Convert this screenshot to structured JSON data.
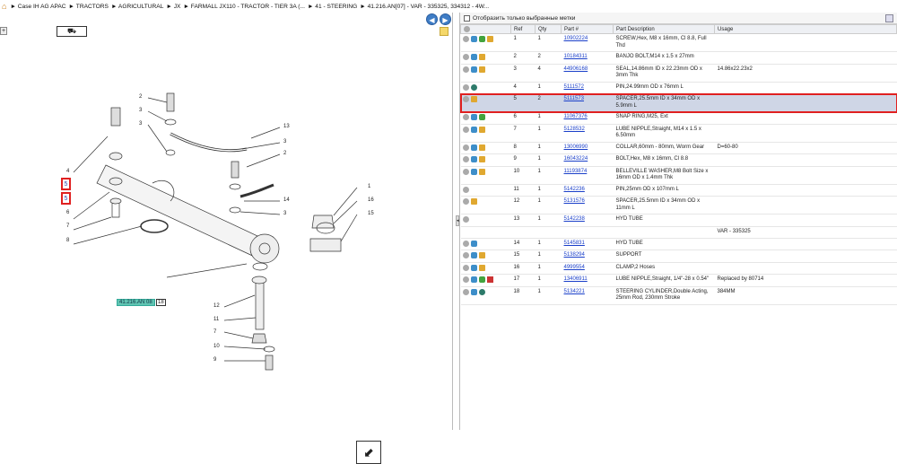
{
  "breadcrumb": {
    "items": [
      "Case IH AG APAC",
      "TRACTORS",
      "AGRICULTURAL",
      "JX",
      "FARMALL JX110 - TRACTOR - TIER 3A (...",
      "41 - STEERING",
      "41.216.AN[07] - VAR - 335325, 334312 - 4W..."
    ]
  },
  "filter": {
    "label": "Отобразить только выбранные метки"
  },
  "table": {
    "headers": [
      "",
      "Ref",
      "Qty",
      "Part #",
      "Part Description",
      "Usage"
    ],
    "rows": [
      {
        "ref": "1",
        "qty": "1",
        "part": "10902224",
        "desc": "SCREW,Hex, M8 x 16mm, Cl 8.8, Full Thd",
        "usage": "",
        "icons": [
          "grey",
          "arrow",
          "green",
          "box"
        ]
      },
      {
        "ref": "2",
        "qty": "2",
        "part": "10184311",
        "desc": "BANJO BOLT,M14 x 1.5 x 27mm",
        "usage": "",
        "icons": [
          "grey",
          "arrow",
          "box"
        ]
      },
      {
        "ref": "3",
        "qty": "4",
        "part": "44906168",
        "desc": "SEAL,14.86mm ID x 22.23mm OD x 3mm Thk",
        "usage": "14.86x22.23x2",
        "icons": [
          "grey",
          "arrow",
          "box"
        ]
      },
      {
        "ref": "4",
        "qty": "1",
        "part": "5111572",
        "desc": "PIN,24.99mm OD x 76mm L",
        "usage": "",
        "icons": [
          "grey",
          "wheel"
        ]
      },
      {
        "ref": "5",
        "qty": "2",
        "part": "5111573",
        "desc": "SPACER,25.5mm ID x 34mm OD x 5.9mm L",
        "usage": "",
        "icons": [
          "grey",
          "box"
        ],
        "selected": true
      },
      {
        "ref": "6",
        "qty": "1",
        "part": "11067376",
        "desc": "SNAP RING,M25, Ext",
        "usage": "",
        "icons": [
          "grey",
          "arrow",
          "green"
        ]
      },
      {
        "ref": "7",
        "qty": "1",
        "part": "5128532",
        "desc": "LUBE NIPPLE,Straight, M14 x 1.5 x 6.50mm",
        "usage": "",
        "icons": [
          "grey",
          "arrow",
          "box"
        ]
      },
      {
        "ref": "8",
        "qty": "1",
        "part": "13006990",
        "desc": "COLLAR,60mm - 80mm, Worm Gear",
        "usage": "D=60-80",
        "icons": [
          "grey",
          "arrow",
          "box"
        ]
      },
      {
        "ref": "9",
        "qty": "1",
        "part": "16043224",
        "desc": "BOLT,Hex, M8 x 16mm, Cl 8.8",
        "usage": "",
        "icons": [
          "grey",
          "arrow",
          "box"
        ]
      },
      {
        "ref": "10",
        "qty": "1",
        "part": "11193874",
        "desc": "BELLEVILLE WASHER,M8 Bolt Size x 16mm OD x 1.4mm Thk",
        "usage": "",
        "icons": [
          "grey",
          "arrow",
          "box"
        ]
      },
      {
        "ref": "11",
        "qty": "1",
        "part": "5142236",
        "desc": "PIN,25mm OD x 107mm L",
        "usage": "",
        "icons": [
          "grey"
        ]
      },
      {
        "ref": "12",
        "qty": "1",
        "part": "5131576",
        "desc": "SPACER,25.5mm ID x 34mm OD x 11mm L",
        "usage": "",
        "icons": [
          "grey",
          "box"
        ]
      },
      {
        "ref": "13",
        "qty": "1",
        "part": "5142238",
        "desc": "HYD TUBE",
        "usage": "",
        "icons": [
          "grey"
        ]
      },
      {
        "ref": "",
        "qty": "",
        "part": "",
        "desc": "",
        "usage": "VAR - 335325",
        "icons": []
      },
      {
        "ref": "14",
        "qty": "1",
        "part": "5145831",
        "desc": "HYD TUBE",
        "usage": "",
        "icons": [
          "grey",
          "arrow"
        ]
      },
      {
        "ref": "15",
        "qty": "1",
        "part": "5138294",
        "desc": "SUPPORT",
        "usage": "",
        "icons": [
          "grey",
          "arrow",
          "box"
        ]
      },
      {
        "ref": "16",
        "qty": "1",
        "part": "4999554",
        "desc": "CLAMP,2 Hoses",
        "usage": "",
        "icons": [
          "grey",
          "arrow",
          "box"
        ]
      },
      {
        "ref": "17",
        "qty": "1",
        "part": "13406911",
        "desc": "LUBE NIPPLE,Straight, 1/4\"-28 x 0.54\"",
        "usage": "Replaced by 80714",
        "icons": [
          "grey",
          "arrow",
          "green",
          "flag"
        ]
      },
      {
        "ref": "18",
        "qty": "1",
        "part": "5134221",
        "desc": "STEERING CYLINDER,Double Acting, 25mm Rod, 230mm Stroke",
        "usage": "384MM",
        "icons": [
          "grey",
          "arrow",
          "wheel"
        ]
      }
    ]
  },
  "diagram": {
    "ref_label": "41.216.AN 08",
    "ref_num": "18",
    "callouts": [
      "2",
      "3",
      "3",
      "13",
      "3",
      "2",
      "4",
      "5",
      "5",
      "6",
      "7",
      "8",
      "14",
      "3",
      "1",
      "16",
      "15",
      "12",
      "11",
      "7",
      "10",
      "9"
    ]
  }
}
